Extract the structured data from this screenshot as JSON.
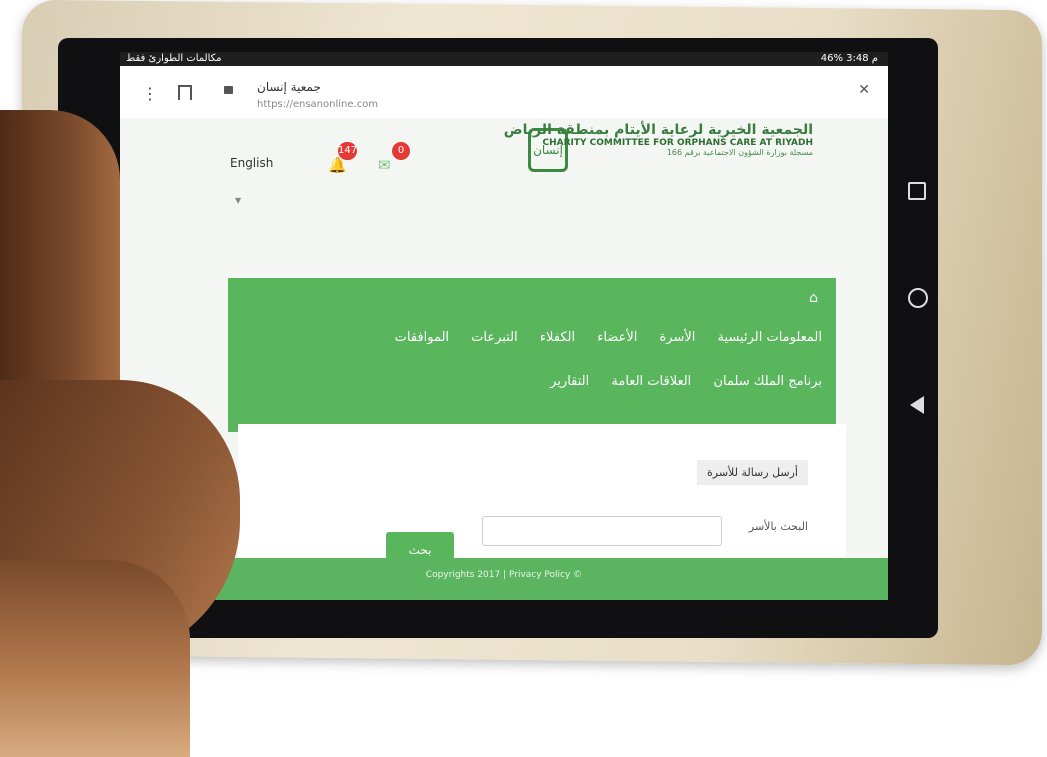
{
  "status_bar": {
    "left": "مكالمات الطوارئ فقط",
    "right": "46% 3:48 م"
  },
  "browser": {
    "page_title": "جمعية إنسان",
    "url": "https://ensanonline.com",
    "menu_icon": "vertical-dots-icon",
    "bookmark_icon": "bookmark-icon",
    "lock_icon": "lock-icon",
    "close_icon": "close-icon"
  },
  "header": {
    "language": "English",
    "notifications_count": "147",
    "messages_count": "0",
    "logo_arabic": "الجمعية الخيرية لرعاية الأيتام بمنطقة الرياض",
    "logo_english": "CHARITY COMMITTEE FOR ORPHANS CARE AT RIYADH",
    "logo_sub": "مسجلة بوزارة الشؤون الاجتماعية برقم 166",
    "logo_mark": "إنسان"
  },
  "menu": {
    "row1": [
      "المعلومات الرئيسية",
      "الأسرة",
      "الأعضاء",
      "الكفلاء",
      "التبرعات",
      "الموافقات"
    ],
    "row2": [
      "برنامج الملك سلمان",
      "العلاقات العامة",
      "التقارير"
    ]
  },
  "content": {
    "send_message": "أرسل رسالة للأسرة",
    "search_label": "البحث بالأسر",
    "search_button": "بحث"
  },
  "footer": {
    "text": "Copyrights 2017 | Privacy Policy ©"
  },
  "colors": {
    "primary_green": "#59b65d",
    "badge_red": "#e53935"
  }
}
